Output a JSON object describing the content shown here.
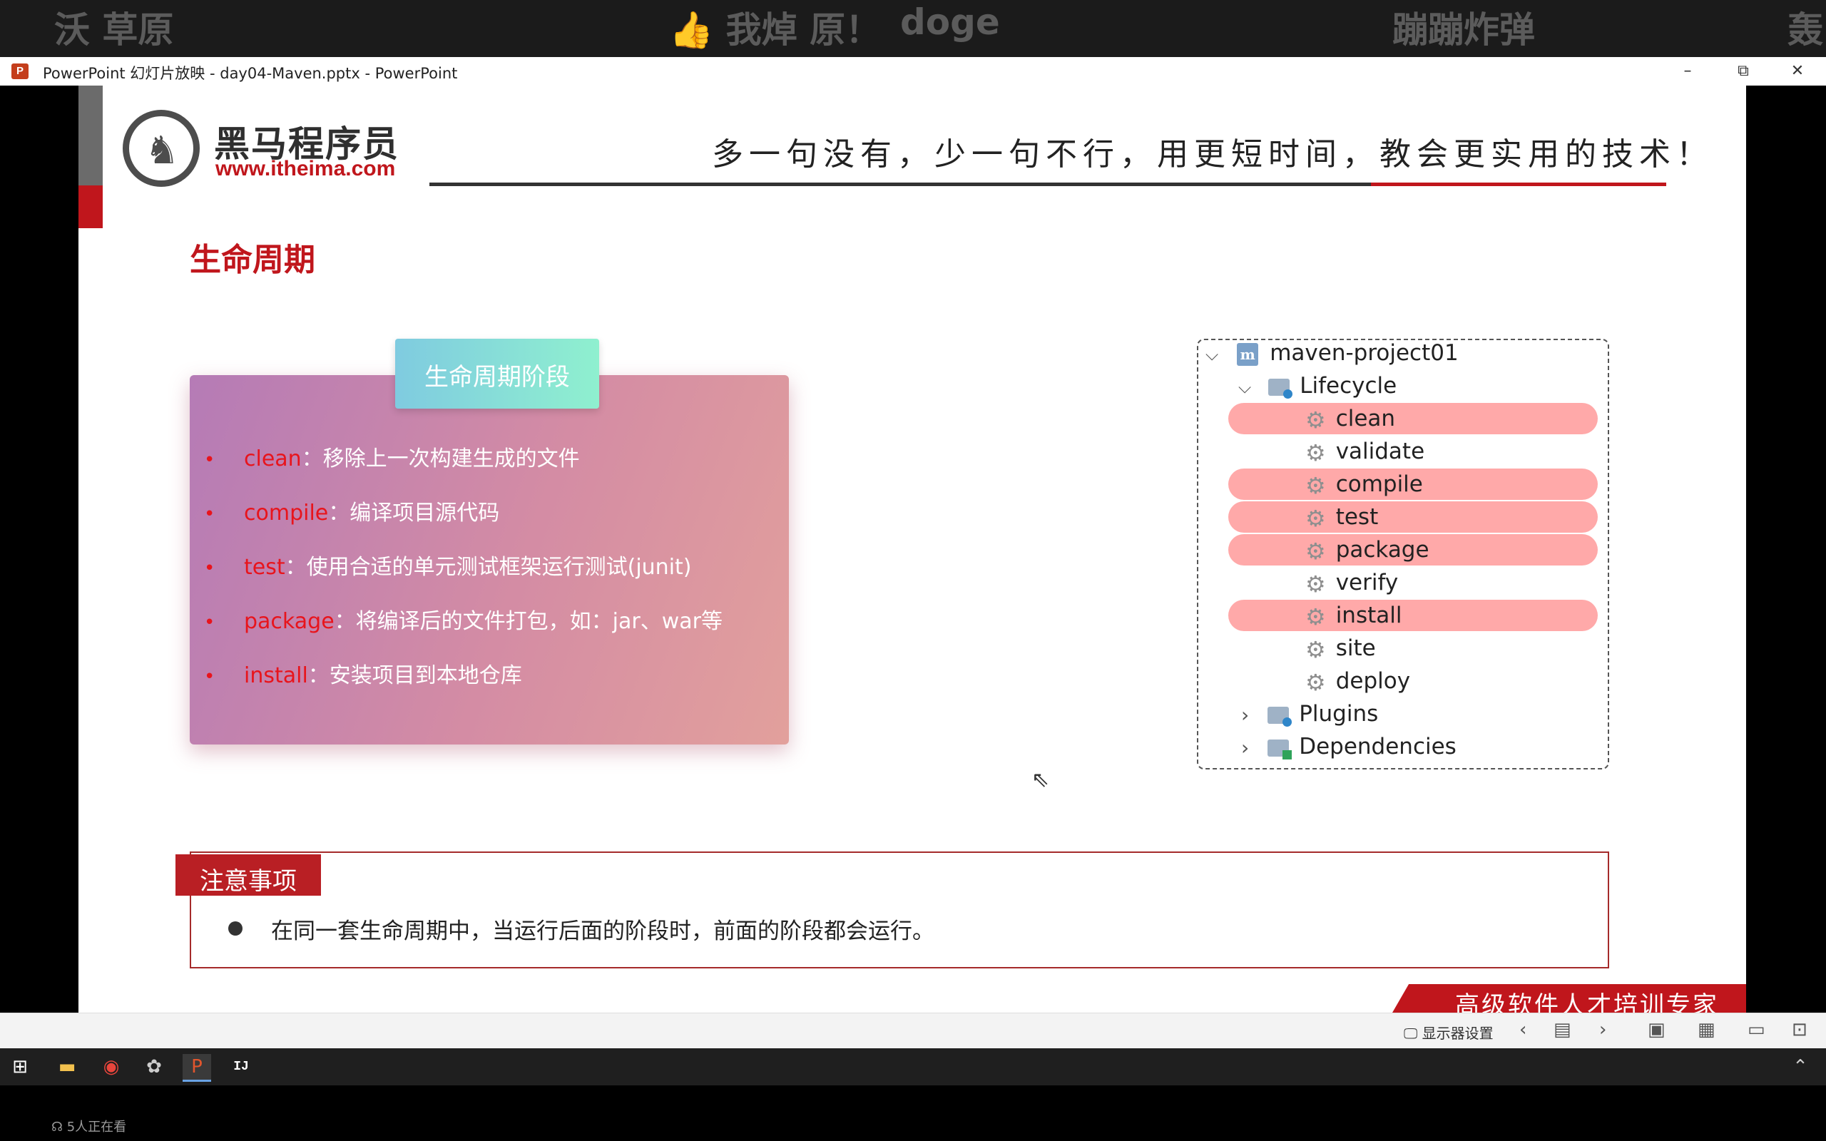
{
  "danmaku": [
    "沃 草原",
    "👍 我焯 原！",
    "doge",
    "蹦蹦炸弹",
    "轰"
  ],
  "window": {
    "title": "PowerPoint 幻灯片放映 - day04-Maven.pptx - PowerPoint",
    "app_icon": "P",
    "controls": {
      "minimize": "–",
      "restore": "⧉",
      "close": "✕"
    }
  },
  "slide": {
    "logo": {
      "name": "黑马程序员",
      "url": "www.itheima.com"
    },
    "slogan": "多一句没有，少一句不行，用更短时间，教会更实用的技术！",
    "title": "生命周期",
    "card": {
      "tab_label": "生命周期阶段",
      "phases": [
        {
          "name": "clean",
          "desc": "：移除上一次构建生成的文件"
        },
        {
          "name": "compile",
          "desc": "：编译项目源代码"
        },
        {
          "name": "test",
          "desc": "：使用合适的单元测试框架运行测试(junit)"
        },
        {
          "name": "package",
          "desc": "：将编译后的文件打包，如：jar、war等"
        },
        {
          "name": "install",
          "desc": "：安装项目到本地仓库"
        }
      ]
    },
    "tree": {
      "project": "maven-project01",
      "lifecycle_label": "Lifecycle",
      "phases": [
        {
          "label": "clean",
          "highlighted": true
        },
        {
          "label": "validate",
          "highlighted": false
        },
        {
          "label": "compile",
          "highlighted": true
        },
        {
          "label": "test",
          "highlighted": true
        },
        {
          "label": "package",
          "highlighted": true
        },
        {
          "label": "verify",
          "highlighted": false
        },
        {
          "label": "install",
          "highlighted": true
        },
        {
          "label": "site",
          "highlighted": false
        },
        {
          "label": "deploy",
          "highlighted": false
        }
      ],
      "plugins_label": "Plugins",
      "dependencies_label": "Dependencies"
    },
    "notice": {
      "tag": "注意事项",
      "text": "在同一套生命周期中，当运行后面的阶段时，前面的阶段都会运行。"
    },
    "footer": "高级软件人才培训专家",
    "colors": {
      "brand_red": "#c0161c",
      "highlight": "#ffa9a9"
    }
  },
  "slideshow_bar": {
    "display_settings": "显示器设置"
  },
  "viewers": "5人正在看"
}
